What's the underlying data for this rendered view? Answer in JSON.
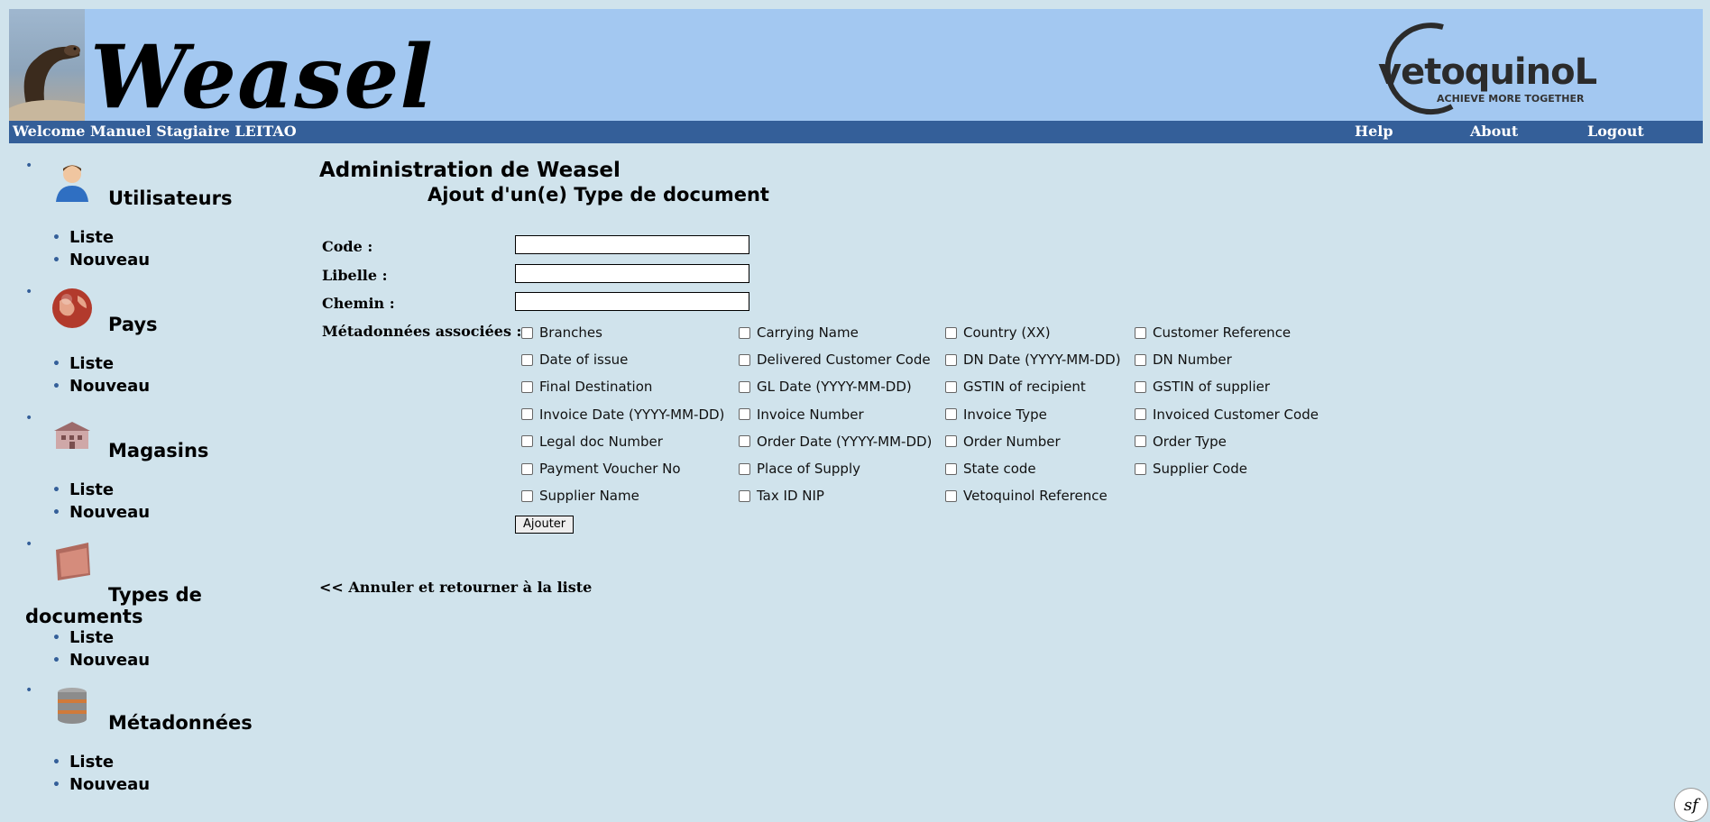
{
  "header": {
    "logo_text": "Weasel",
    "company_name": "vetoquinoL",
    "company_tagline": "ACHIEVE MORE TOGETHER",
    "welcome": "Welcome Manuel Stagiaire LEITAO",
    "links": [
      "Help",
      "About",
      "Logout"
    ]
  },
  "sidebar": {
    "sections": [
      {
        "title": "Utilisateurs",
        "icon": "user-icon",
        "items": [
          "Liste",
          "Nouveau"
        ]
      },
      {
        "title": "Pays",
        "icon": "globe-icon",
        "items": [
          "Liste",
          "Nouveau"
        ]
      },
      {
        "title": "Magasins",
        "icon": "store-icon",
        "items": [
          "Liste",
          "Nouveau"
        ]
      },
      {
        "title": "Types de documents",
        "icon": "folder-icon",
        "items": [
          "Liste",
          "Nouveau"
        ]
      },
      {
        "title": "Métadonnées",
        "icon": "database-icon",
        "items": [
          "Liste",
          "Nouveau"
        ]
      }
    ]
  },
  "main": {
    "title": "Administration de Weasel",
    "subtitle": "Ajout d'un(e) Type de document",
    "fields": {
      "code_label": "Code :",
      "code_value": "",
      "libelle_label": "Libelle :",
      "libelle_value": "",
      "chemin_label": "Chemin :",
      "chemin_value": "",
      "metadata_label": "Métadonnées associées :"
    },
    "metadata_options": [
      "Branches",
      "Carrying Name",
      "Country (XX)",
      "Customer Reference",
      "Date of issue",
      "Delivered Customer Code",
      "DN Date (YYYY-MM-DD)",
      "DN Number",
      "Final Destination",
      "GL Date (YYYY-MM-DD)",
      "GSTIN of recipient",
      "GSTIN of supplier",
      "Invoice Date (YYYY-MM-DD)",
      "Invoice Number",
      "Invoice Type",
      "Invoiced Customer Code",
      "Legal doc Number",
      "Order Date (YYYY-MM-DD)",
      "Order Number",
      "Order Type",
      "Payment Voucher No",
      "Place of Supply",
      "State code",
      "Supplier Code",
      "Supplier Name",
      "Tax ID NIP",
      "Vetoquinol Reference"
    ],
    "submit_label": "Ajouter",
    "cancel_link": "<< Annuler et retourner à la liste"
  },
  "footer": {
    "badge": "sf"
  }
}
